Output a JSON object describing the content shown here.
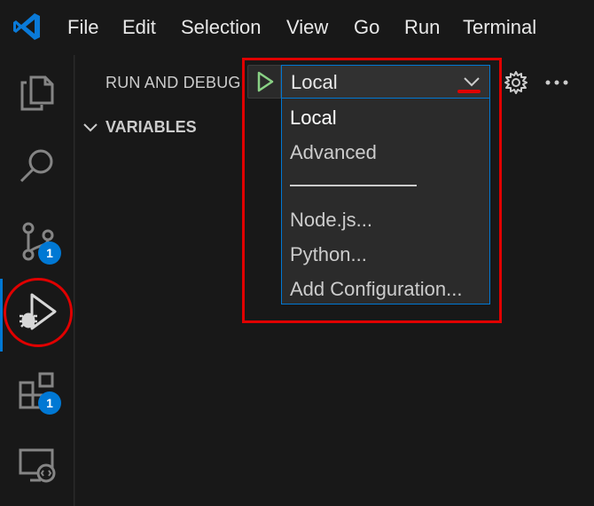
{
  "menubar": {
    "items": [
      "File",
      "Edit",
      "Selection",
      "View",
      "Go",
      "Run",
      "Terminal"
    ]
  },
  "activitybar": {
    "icons": [
      "explorer-icon",
      "search-icon",
      "source-control-icon",
      "run-debug-icon",
      "extensions-icon",
      "remote-explorer-icon"
    ],
    "source_control_badge": "1",
    "extensions_badge": "1"
  },
  "sidebar": {
    "title": "RUN AND DEBUG",
    "config_selected": "Local",
    "variables_label": "VARIABLES"
  },
  "dropdown": {
    "options": [
      "Local",
      "Advanced",
      "Node.js...",
      "Python...",
      "Add Configuration..."
    ]
  },
  "colors": {
    "accent": "#0078d4",
    "run_green": "#89d185",
    "annotation_red": "#e00000",
    "background": "#181818"
  }
}
